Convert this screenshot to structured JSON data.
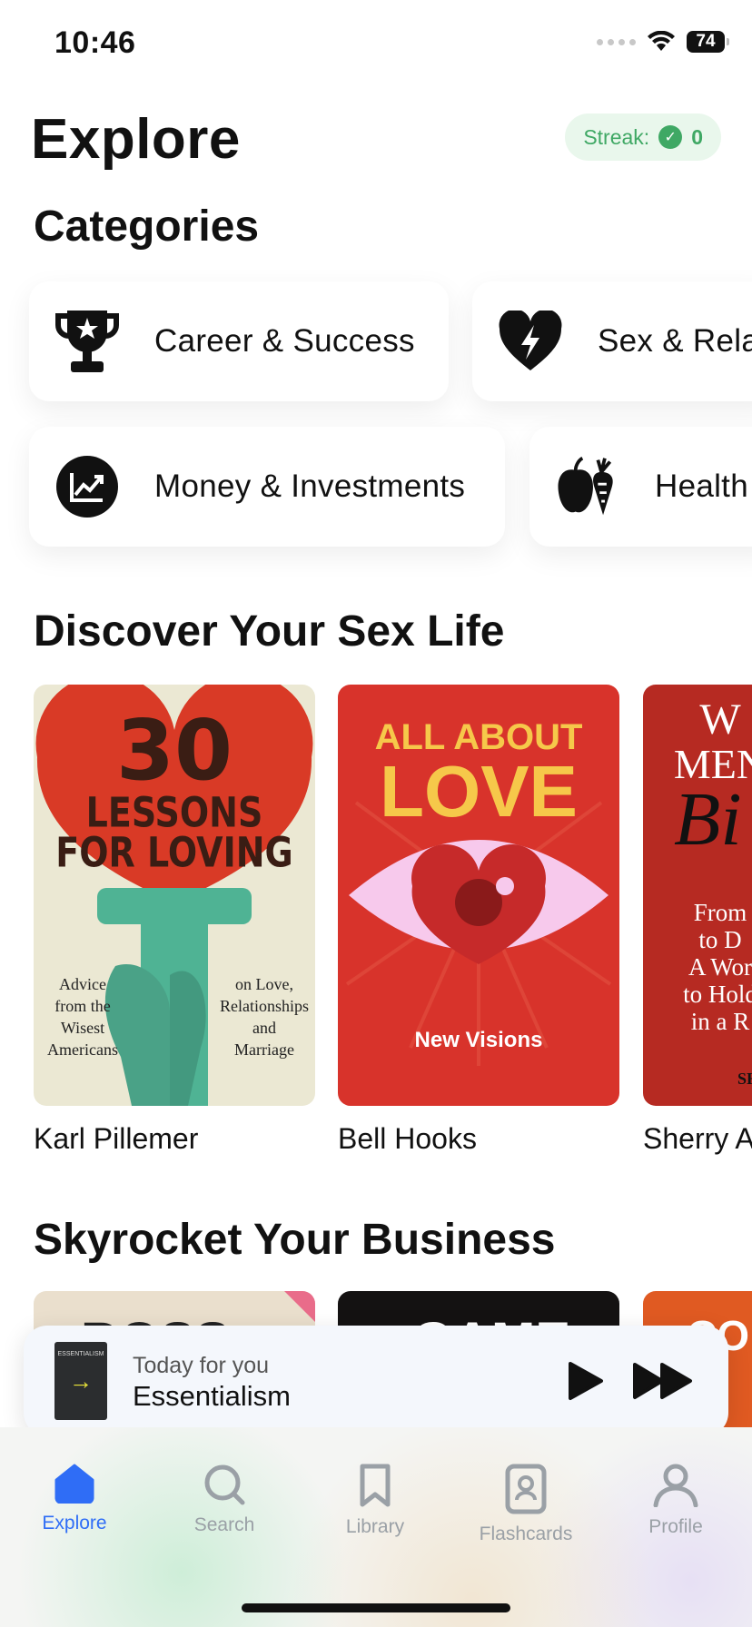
{
  "status_bar": {
    "time": "10:46",
    "battery": "74"
  },
  "header": {
    "title": "Explore",
    "streak_label": "Streak:",
    "streak_count": "0"
  },
  "categories": {
    "title": "Categories",
    "items": [
      {
        "label": "Career & Success",
        "icon": "trophy-icon"
      },
      {
        "label": "Sex & Rela",
        "icon": "heart-bolt-icon"
      },
      {
        "label": "Money & Investments",
        "icon": "chart-up-icon"
      },
      {
        "label": "Health",
        "icon": "apple-carrot-icon"
      }
    ]
  },
  "sex_life": {
    "title": "Discover Your Sex Life",
    "books": [
      {
        "author": "Karl Pillemer",
        "cover": {
          "line1": "30",
          "line2": "LESSONS",
          "line3": "FOR LOVING",
          "left_text": [
            "Advice",
            "from the",
            "Wisest",
            "Americans"
          ],
          "right_text": [
            "on Love,",
            "Relationships",
            "and",
            "Marriage"
          ]
        }
      },
      {
        "author": "Bell Hooks",
        "cover": {
          "line1": "ALL ABOUT",
          "line2": "LOVE",
          "subtitle": "New Visions"
        }
      },
      {
        "author": "Sherry A",
        "cover": {
          "line1": "W",
          "line2": "MEN",
          "line3": "Bi",
          "body": [
            "From",
            "to D",
            "A Wor",
            "to Hold",
            "in a R"
          ],
          "footer": "SHE"
        }
      }
    ]
  },
  "business": {
    "title": "Skyrocket Your Business",
    "books": [
      {
        "peek": "BOSS"
      },
      {
        "peek": "GAME"
      },
      {
        "peek": "CON"
      }
    ]
  },
  "player": {
    "subtitle": "Today for you",
    "title": "Essentialism",
    "cover_title": "ESSENTIALISM"
  },
  "tabs": [
    {
      "label": "Explore",
      "icon": "home-icon",
      "active": true
    },
    {
      "label": "Search",
      "icon": "search-icon"
    },
    {
      "label": "Library",
      "icon": "bookmark-icon"
    },
    {
      "label": "Flashcards",
      "icon": "flashcards-icon"
    },
    {
      "label": "Profile",
      "icon": "profile-icon"
    }
  ],
  "colors": {
    "accent": "#2f6df6",
    "streak": "#3fa864"
  }
}
